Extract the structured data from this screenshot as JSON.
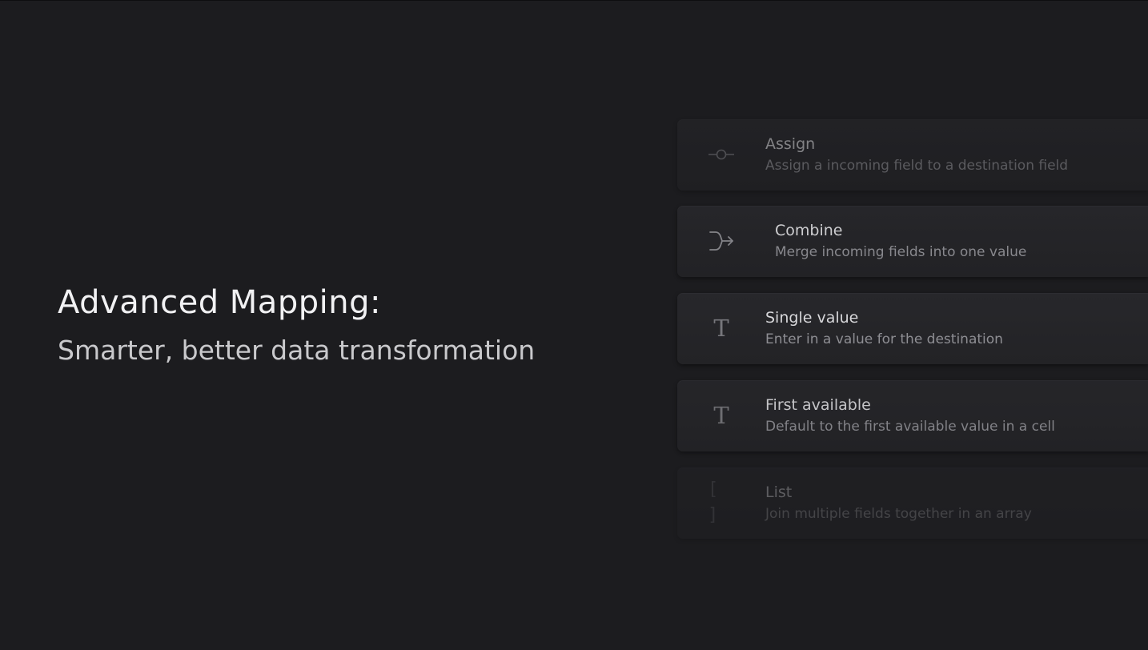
{
  "hero": {
    "title": "Advanced Mapping:",
    "subtitle": "Smarter, better data transformation"
  },
  "options": [
    {
      "icon": "assign-icon",
      "label": "Assign",
      "description": "Assign a incoming field to a destination field"
    },
    {
      "icon": "merge-arrow-icon",
      "label": "Combine",
      "description": "Merge incoming fields into one value"
    },
    {
      "icon": "text-icon",
      "icon_glyph": "T",
      "label": "Single value",
      "description": "Enter in a value for the destination"
    },
    {
      "icon": "text-icon",
      "icon_glyph": "T",
      "label": "First available",
      "description": "Default to the first available value in a cell"
    },
    {
      "icon": "brackets-icon",
      "icon_glyph": "[ ]",
      "label": "List",
      "description": "Join multiple fields together in an array"
    }
  ],
  "colors": {
    "background": "#1c1c1f",
    "card": "#27272b",
    "title": "#f1f1f3",
    "subtitle": "#c9c9cc",
    "label": "#d7d7da",
    "description": "#8e8e93",
    "icon": "#77777c"
  }
}
